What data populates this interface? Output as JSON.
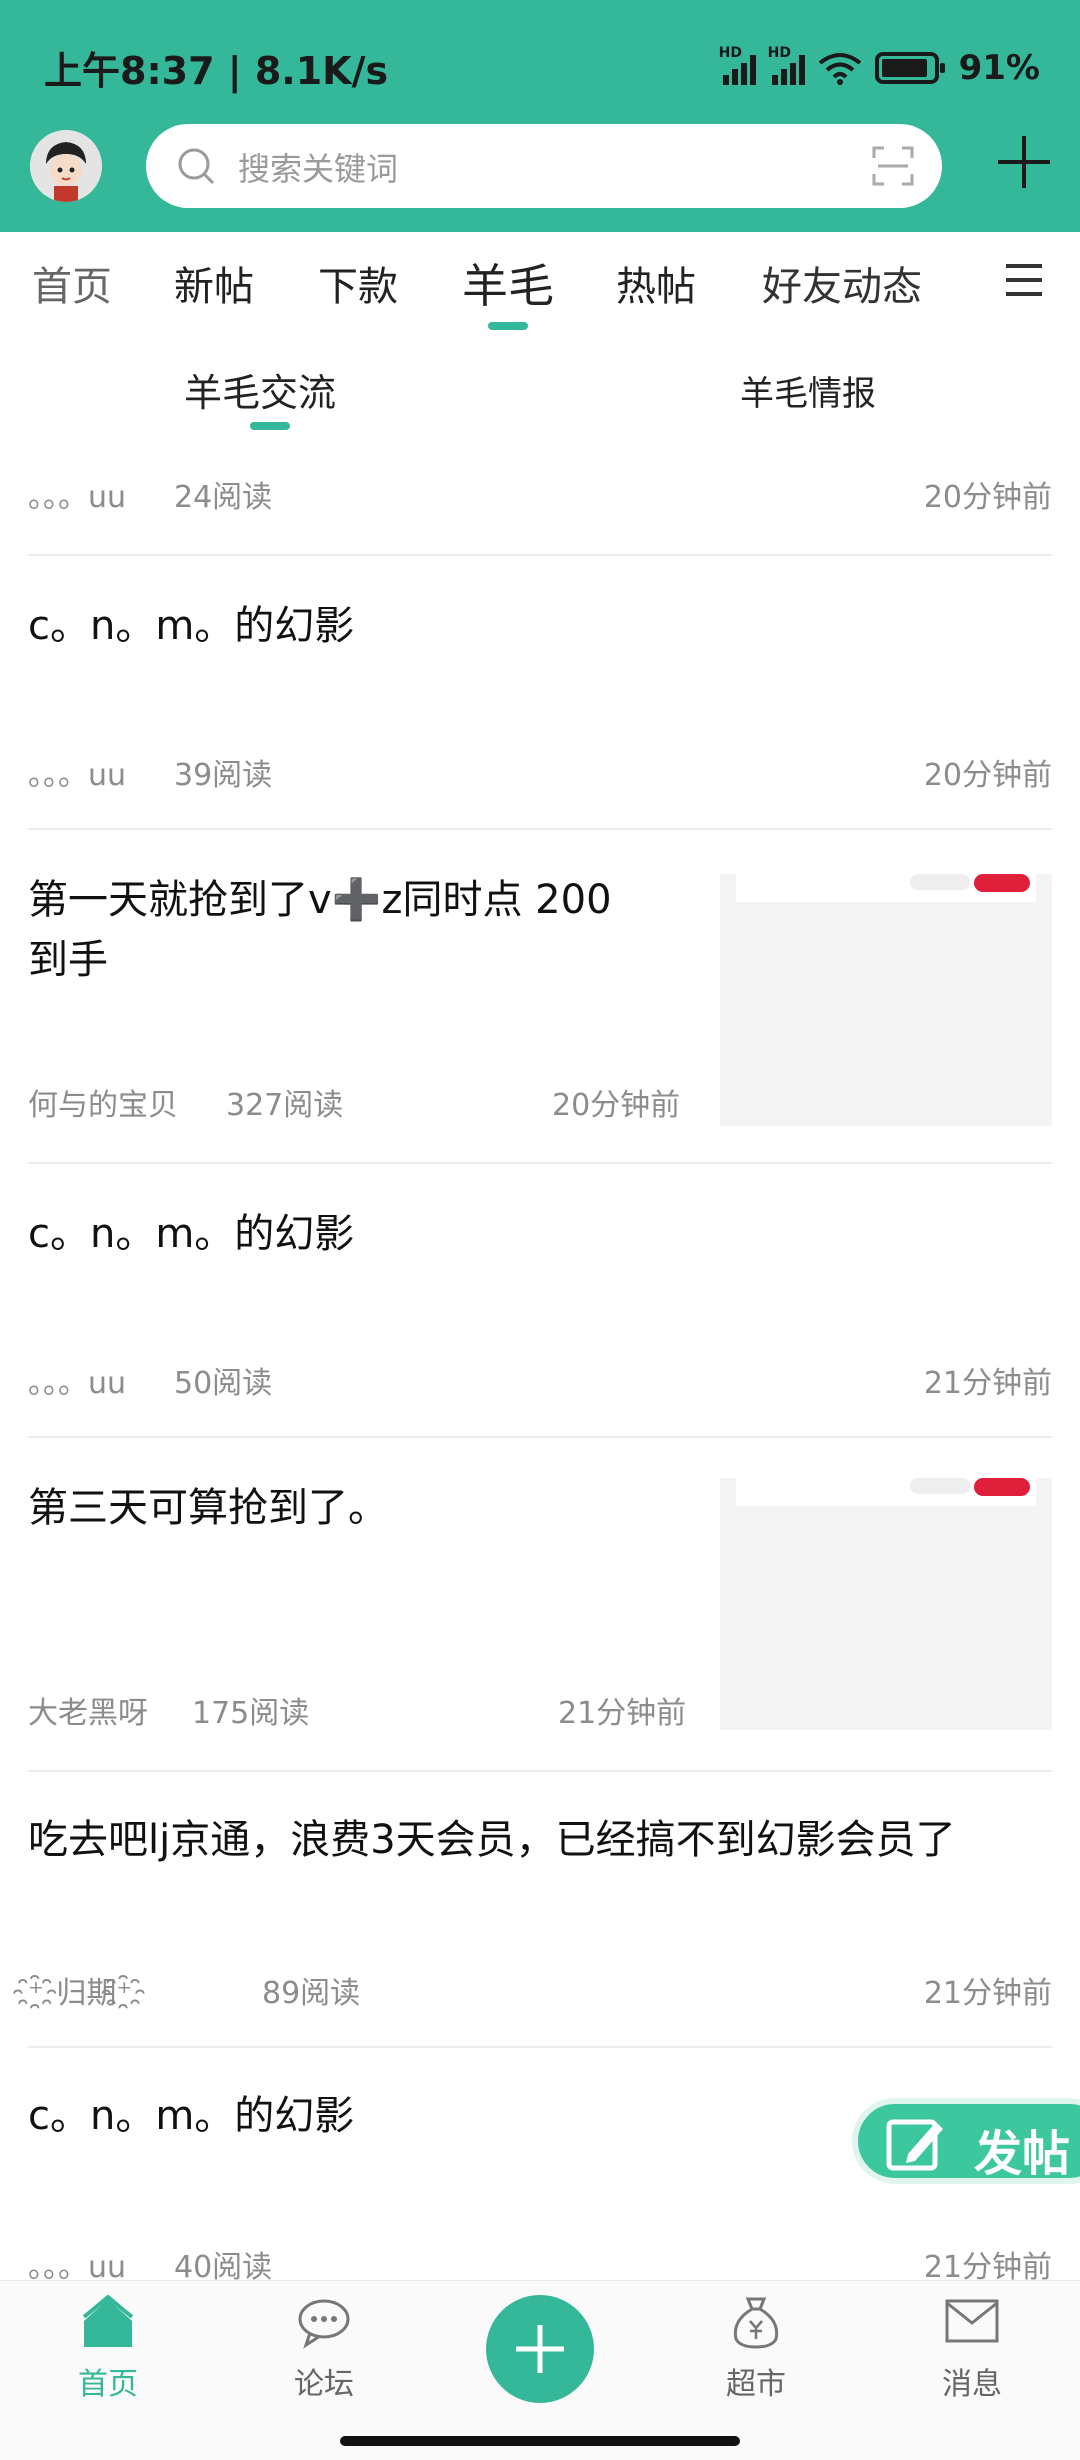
{
  "status_bar": {
    "time": "上午8:37 | 8.1K/s",
    "battery": "91%",
    "signal_label": "HD"
  },
  "header": {
    "search_placeholder": "搜索关键词"
  },
  "tabs": [
    {
      "label": "首页",
      "active": false
    },
    {
      "label": "新帖",
      "active": false
    },
    {
      "label": "下款",
      "active": false
    },
    {
      "label": "羊毛",
      "active": true
    },
    {
      "label": "热帖",
      "active": false
    },
    {
      "label": "好友动态",
      "active": false
    }
  ],
  "subtabs": [
    {
      "label": "羊毛交流",
      "active": true
    },
    {
      "label": "羊毛情报",
      "active": false
    }
  ],
  "posts": [
    {
      "title": "",
      "author": "。。。uu",
      "reads": "24阅读",
      "time": "20分钟前"
    },
    {
      "title": "c。n。m。的幻影",
      "author": "。。。uu",
      "reads": "39阅读",
      "time": "20分钟前"
    },
    {
      "title_line1": "第一天就抢到了v➕z同时点 200",
      "title_line2": "到手",
      "author": "何与的宝贝",
      "reads": "327阅读",
      "time": "20分钟前",
      "has_thumb": true
    },
    {
      "title": "c。n。m。的幻影",
      "author": "。。。uu",
      "reads": "50阅读",
      "time": "21分钟前"
    },
    {
      "title": "第三天可算抢到了。",
      "author": "大老黑呀",
      "reads": "175阅读",
      "time": "21分钟前",
      "has_thumb": true
    },
    {
      "title": "吃去吧lj京通，浪费3天会员，已经搞不到幻影会员了",
      "author": "⁺҈归期⁺҈",
      "reads": "89阅读",
      "time": "21分钟前"
    },
    {
      "title": "c。n。m。的幻影",
      "author": "。。。uu",
      "reads": "40阅读",
      "time": "21分钟前"
    }
  ],
  "fab_post_label": "发帖",
  "bottom_nav": [
    {
      "label": "首页",
      "icon": "home-icon",
      "active": true
    },
    {
      "label": "论坛",
      "icon": "chat-bubble-icon",
      "active": false
    },
    {
      "label": "",
      "icon": "plus-icon",
      "active": false
    },
    {
      "label": "超市",
      "icon": "money-bag-icon",
      "active": false
    },
    {
      "label": "消息",
      "icon": "envelope-icon",
      "active": false
    }
  ],
  "colors": {
    "accent": "#35b89a",
    "badge_red": "#e0203a"
  }
}
